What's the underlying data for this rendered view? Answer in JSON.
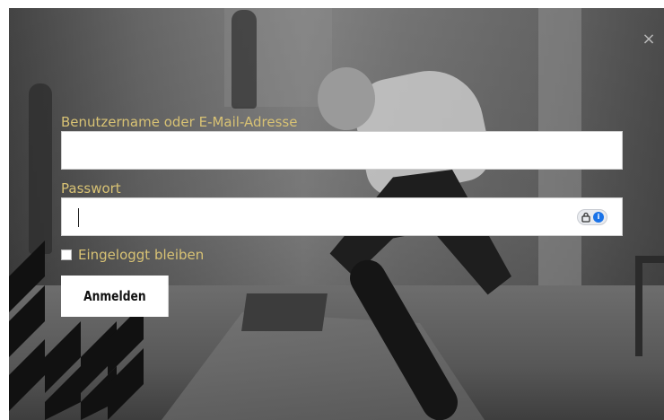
{
  "window": {
    "close_icon": "close-icon",
    "close_glyph": "×"
  },
  "form": {
    "username_label": "Benutzername oder E-Mail-Adresse",
    "username_value": "",
    "password_label": "Passwort",
    "password_value": "",
    "password_manager_icon": "password-manager-icon",
    "password_manager_glyph": "i",
    "remember_label": "Eingeloggt bleiben",
    "remember_checked": false,
    "submit_label": "Anmelden"
  },
  "colors": {
    "label": "#d8c274",
    "field_bg": "#ffffff",
    "button_bg": "#ffffff",
    "button_text": "#111111",
    "password_manager_accent": "#1a73e8"
  }
}
